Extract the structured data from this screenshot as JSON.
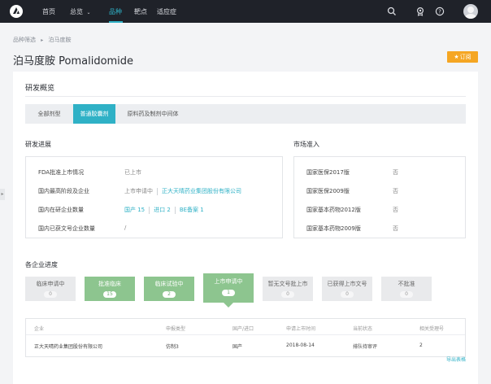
{
  "nav": {
    "items": [
      "首页",
      "总览",
      "品种",
      "靶点",
      "适应症"
    ],
    "active_index": 2,
    "overview_caret": "⌄"
  },
  "breadcrumb": [
    "品种筛选",
    "泊马度胺"
  ],
  "page_title": "泊马度胺 Pomalidomide",
  "subscribe": {
    "star": "★",
    "label": "订阅"
  },
  "card": {
    "title": "研发概览",
    "tabs": [
      "全部剂型",
      "普通胶囊剂",
      "原料药及制剂中间体"
    ],
    "active_tab": 1
  },
  "progress": {
    "title": "研发进展",
    "rows": [
      {
        "label": "FDA批准上市情况",
        "value": "已上市"
      },
      {
        "label": "国内最高阶段及企业",
        "value": "上市申请中",
        "link": "正大天晴药业集团股份有限公司"
      },
      {
        "label": "国内在研企业数量",
        "links": [
          "国产 15",
          "进口 2",
          "BE备案 1"
        ]
      },
      {
        "label": "国内已获文号企业数量",
        "value": "/"
      }
    ]
  },
  "market": {
    "title": "市场准入",
    "rows": [
      {
        "label": "国家医保2017版",
        "value": "否"
      },
      {
        "label": "国家医保2009版",
        "value": "否"
      },
      {
        "label": "国家基本药物2012版",
        "value": "否"
      },
      {
        "label": "国家基本药物2009版",
        "value": "否"
      }
    ]
  },
  "companies": {
    "title": "各企业进度",
    "stages": [
      {
        "name": "临床申请中",
        "count": "0",
        "state": "grey"
      },
      {
        "name": "批准临床",
        "count": "15",
        "state": "green"
      },
      {
        "name": "临床试验中",
        "count": "2",
        "state": "green"
      },
      {
        "name": "上市申请中",
        "count": "1",
        "state": "green-selected"
      },
      {
        "name": "暂无文号批上市",
        "count": "0",
        "state": "grey"
      },
      {
        "name": "已获得上市文号",
        "count": "0",
        "state": "grey"
      },
      {
        "name": "不批准",
        "count": "0",
        "state": "grey"
      }
    ],
    "table": {
      "headers": [
        "企业",
        "申报类型",
        "国产/进口",
        "申请上市时间",
        "当前状态",
        "相关受理号"
      ],
      "rows": [
        [
          "正大天晴药业集团股份有限公司",
          "仿制3",
          "国产",
          "2018-08-14",
          "排队待审评",
          "2"
        ]
      ]
    },
    "export_label": "导出表格"
  },
  "colors": {
    "accent": "#2fb1c6",
    "green": "#8dc58f",
    "orange": "#f5a623",
    "nav_bg": "#1f2229"
  },
  "icons": [
    "logo-icon",
    "search-icon",
    "award-icon",
    "help-icon",
    "avatar",
    "star-icon",
    "chevron-right-icon"
  ]
}
